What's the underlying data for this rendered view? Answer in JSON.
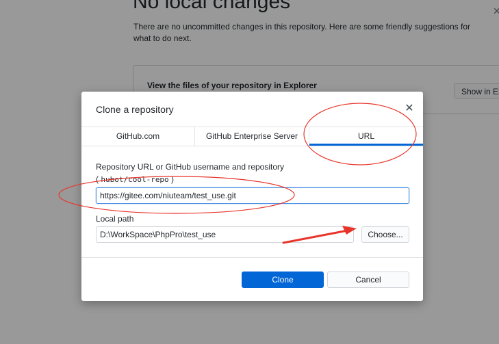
{
  "background": {
    "title": "No local changes",
    "description": "There are no uncommitted changes in this repository. Here are some friendly suggestions for what to do next.",
    "card_text": "View the files of your repository in Explorer",
    "card_button": "Show in Explorer"
  },
  "dialog": {
    "title": "Clone a repository",
    "close_glyph": "✕",
    "tabs": [
      {
        "label": "GitHub.com"
      },
      {
        "label": "GitHub Enterprise Server"
      },
      {
        "label": "URL"
      }
    ],
    "url_label": "Repository URL or GitHub username and repository",
    "url_hint_open": "(",
    "url_hint_example": "hubot/cool-repo",
    "url_hint_close": ")",
    "url_value": "https://gitee.com/niuteam/test_use.git",
    "path_label": "Local path",
    "path_value": "D:\\WorkSpace\\PhpPro\\test_use",
    "choose_label": "Choose...",
    "clone_label": "Clone",
    "cancel_label": "Cancel"
  },
  "colors": {
    "accent": "#0366d6",
    "annotation": "#e8352b"
  }
}
